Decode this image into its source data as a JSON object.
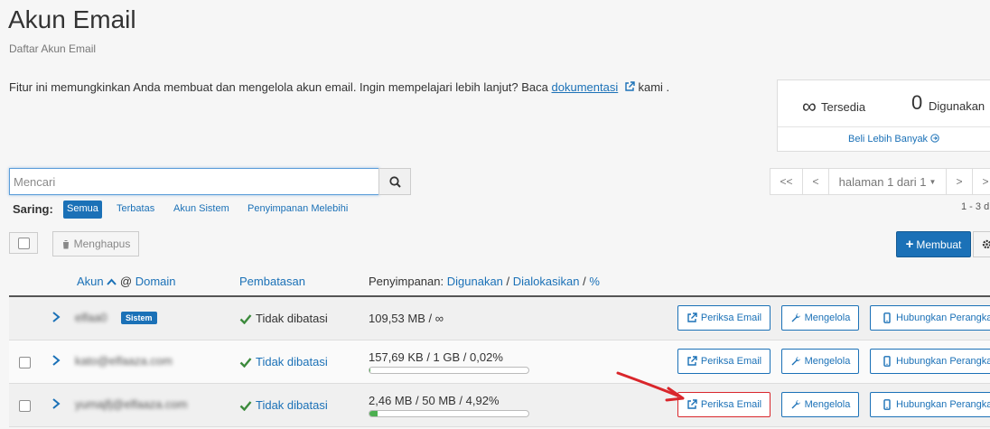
{
  "page": {
    "title": "Akun Email",
    "subtitle": "Daftar Akun Email",
    "intro_text": "Fitur ini memungkinkan Anda membuat dan mengelola akun email. Ingin mempelajari lebih lanjut? Baca ",
    "intro_link": "dokumentasi",
    "intro_suffix": " kami ."
  },
  "stats": {
    "available_symbol": "∞",
    "available_label": "Tersedia",
    "used_value": "0",
    "used_label": "Digunakan",
    "buy_more": "Beli Lebih Banyak"
  },
  "search": {
    "placeholder": "Mencari",
    "value": ""
  },
  "pager": {
    "first": "<<",
    "prev": "<",
    "page_label": "halaman 1 dari 1",
    "next": ">",
    "last": ">",
    "range": "1 - 3 d"
  },
  "filters": {
    "label": "Saring:",
    "items": [
      "Semua",
      "Terbatas",
      "Akun Sistem",
      "Penyimpanan Melebihi"
    ],
    "active": "Semua"
  },
  "toolbar": {
    "delete_label": "Menghapus",
    "create_label": "Membuat"
  },
  "table": {
    "headers": {
      "account": "Akun",
      "at": "@",
      "domain": "Domain",
      "restriction": "Pembatasan",
      "storage_prefix": "Penyimpanan:",
      "storage_used": "Digunakan",
      "storage_allocated": "Dialokasikan",
      "storage_percent": "%",
      "slash": "/"
    },
    "rows": [
      {
        "account": "elfaa0",
        "badge": "Sistem",
        "restriction": "Tidak dibatasi",
        "storage": "109,53 MB / ∞",
        "percent": null,
        "checkbox": false
      },
      {
        "account": "kato@elfaaza.com",
        "badge": "",
        "restriction": "Tidak dibatasi",
        "storage": "157,69 KB / 1 GB / 0,02%",
        "percent": 0.02,
        "checkbox": true
      },
      {
        "account": "yumajfj@elfaaza.com",
        "badge": "",
        "restriction": "Tidak dibatasi",
        "storage": "2,46 MB / 50 MB / 4,92%",
        "percent": 4.92,
        "checkbox": true
      }
    ],
    "actions": {
      "check_email": "Periksa Email",
      "manage": "Mengelola",
      "connect": "Hubungkan Perangkat"
    }
  },
  "colors": {
    "accent": "#1b71b7",
    "check_green": "#3c8a3c",
    "arrow_red": "#d9262b"
  }
}
